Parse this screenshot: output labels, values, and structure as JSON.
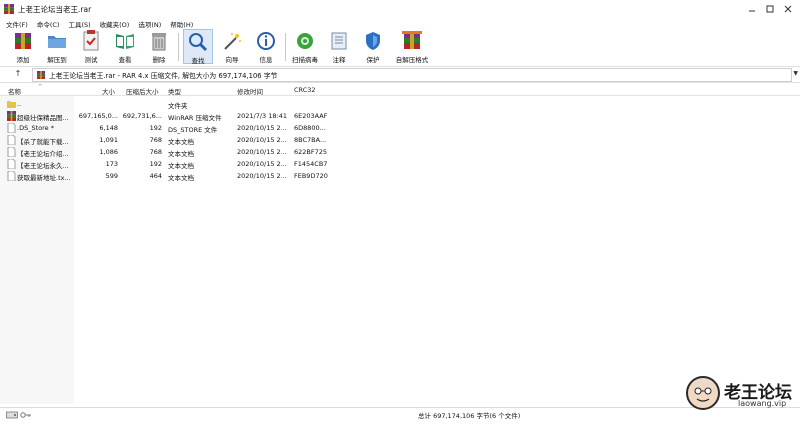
{
  "window": {
    "title": "上老王论坛当老王.rar",
    "controls": [
      "minimize",
      "maximize",
      "close"
    ]
  },
  "menu": [
    "文件(F)",
    "命令(C)",
    "工具(S)",
    "收藏夹(O)",
    "选项(N)",
    "帮助(H)"
  ],
  "toolbar": [
    {
      "label": "添加",
      "icon": "add-archive-icon"
    },
    {
      "label": "解压到",
      "icon": "extract-to-icon"
    },
    {
      "label": "测试",
      "icon": "test-icon"
    },
    {
      "label": "查看",
      "icon": "view-icon"
    },
    {
      "label": "删除",
      "icon": "delete-icon"
    },
    {
      "label": "查找",
      "icon": "find-icon",
      "selected": true
    },
    {
      "label": "向导",
      "icon": "wizard-icon"
    },
    {
      "label": "信息",
      "icon": "info-icon"
    },
    {
      "label": "扫描病毒",
      "icon": "virus-scan-icon"
    },
    {
      "label": "注释",
      "icon": "comment-icon"
    },
    {
      "label": "保护",
      "icon": "protect-icon"
    },
    {
      "label": "自解压格式",
      "icon": "sfx-icon"
    }
  ],
  "address": {
    "text": "上老王论坛当老王.rar - RAR 4.x 压缩文件, 解包大小为 697,174,106 字节"
  },
  "columns": {
    "name": "名称",
    "size": "大小",
    "packed": "压缩后大小",
    "type": "类型",
    "modified": "修改时间",
    "crc": "CRC32"
  },
  "files": [
    {
      "name": "..",
      "size": "",
      "packed": "",
      "type": "文件夹",
      "modified": "",
      "crc": "",
      "icon": "folder"
    },
    {
      "name": "超级壮保精品图...",
      "size": "697,165,0...",
      "packed": "692,731,6...",
      "type": "WinRAR 压缩文件",
      "modified": "2021/7/3 18:41",
      "crc": "6E203AAF",
      "icon": "rar"
    },
    {
      "name": ".DS_Store *",
      "size": "6,148",
      "packed": "192",
      "type": "DS_STORE 文件",
      "modified": "2020/10/15 2...",
      "crc": "6D8800...",
      "icon": "doc"
    },
    {
      "name": "【杀了就能下载...",
      "size": "1,091",
      "packed": "768",
      "type": "文本文档",
      "modified": "2020/10/15 2...",
      "crc": "8BC7BA...",
      "icon": "doc"
    },
    {
      "name": "【老王论坛介绍...",
      "size": "1,086",
      "packed": "768",
      "type": "文本文档",
      "modified": "2020/10/15 2...",
      "crc": "622BF725",
      "icon": "doc"
    },
    {
      "name": "【老王论坛永久...",
      "size": "173",
      "packed": "192",
      "type": "文本文档",
      "modified": "2020/10/15 2...",
      "crc": "F1454CB7",
      "icon": "doc"
    },
    {
      "name": "获取最新地址.tx...",
      "size": "599",
      "packed": "464",
      "type": "文本文档",
      "modified": "2020/10/15 2...",
      "crc": "FEB9D720",
      "icon": "doc"
    }
  ],
  "status": {
    "text": "总计 697,174,106 字节(6 个文件)"
  },
  "watermark": {
    "brand": "老王论坛",
    "url": "laowang.vip"
  }
}
